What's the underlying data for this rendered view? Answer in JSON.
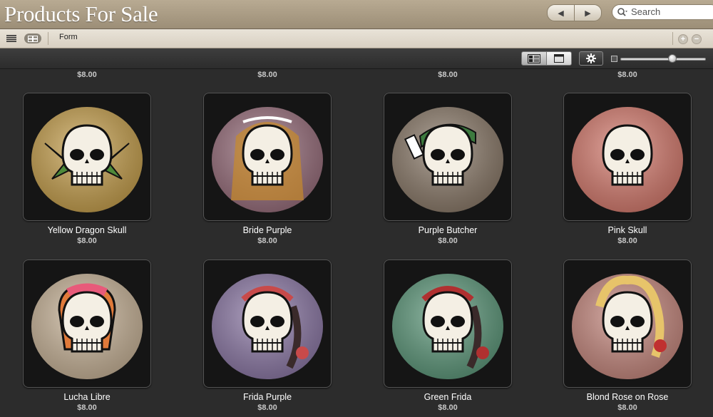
{
  "window": {
    "title": "Products For Sale"
  },
  "nav": {
    "back_glyph": "◀",
    "forward_glyph": "▶"
  },
  "search": {
    "placeholder": "Search",
    "value": ""
  },
  "toolbar": {
    "form_label": "Form",
    "add_glyph": "+",
    "remove_glyph": "−"
  },
  "prev_row_prices": [
    "$8.00",
    "$8.00",
    "$8.00",
    "$8.00"
  ],
  "products": [
    {
      "name": "Yellow Dragon Skull",
      "price": "$8.00",
      "shell_color": "#c9a24e",
      "accent": "#4e8a3a",
      "motif": "crossbones"
    },
    {
      "name": "Bride Purple",
      "price": "$8.00",
      "shell_color": "#9a6f7d",
      "accent": "#c88a2a",
      "motif": "bride"
    },
    {
      "name": "Purple Butcher",
      "price": "$8.00",
      "shell_color": "#8d7c6b",
      "accent": "#3c7a3e",
      "motif": "bandana"
    },
    {
      "name": "Pink Skull",
      "price": "$8.00",
      "shell_color": "#d97d70",
      "accent": "#e8c9a0",
      "motif": "plain"
    },
    {
      "name": "Lucha Libre",
      "price": "$8.00",
      "shell_color": "#cbb69a",
      "accent": "#e07a3a",
      "motif": "mask"
    },
    {
      "name": "Frida Purple",
      "price": "$8.00",
      "shell_color": "#8e7aa8",
      "accent": "#c84a4a",
      "motif": "flowers"
    },
    {
      "name": "Green Frida",
      "price": "$8.00",
      "shell_color": "#5e9a7c",
      "accent": "#b03030",
      "motif": "flowers"
    },
    {
      "name": "Blond Rose on Rose",
      "price": "$8.00",
      "shell_color": "#c98a80",
      "accent": "#e7c46a",
      "motif": "blond"
    }
  ]
}
